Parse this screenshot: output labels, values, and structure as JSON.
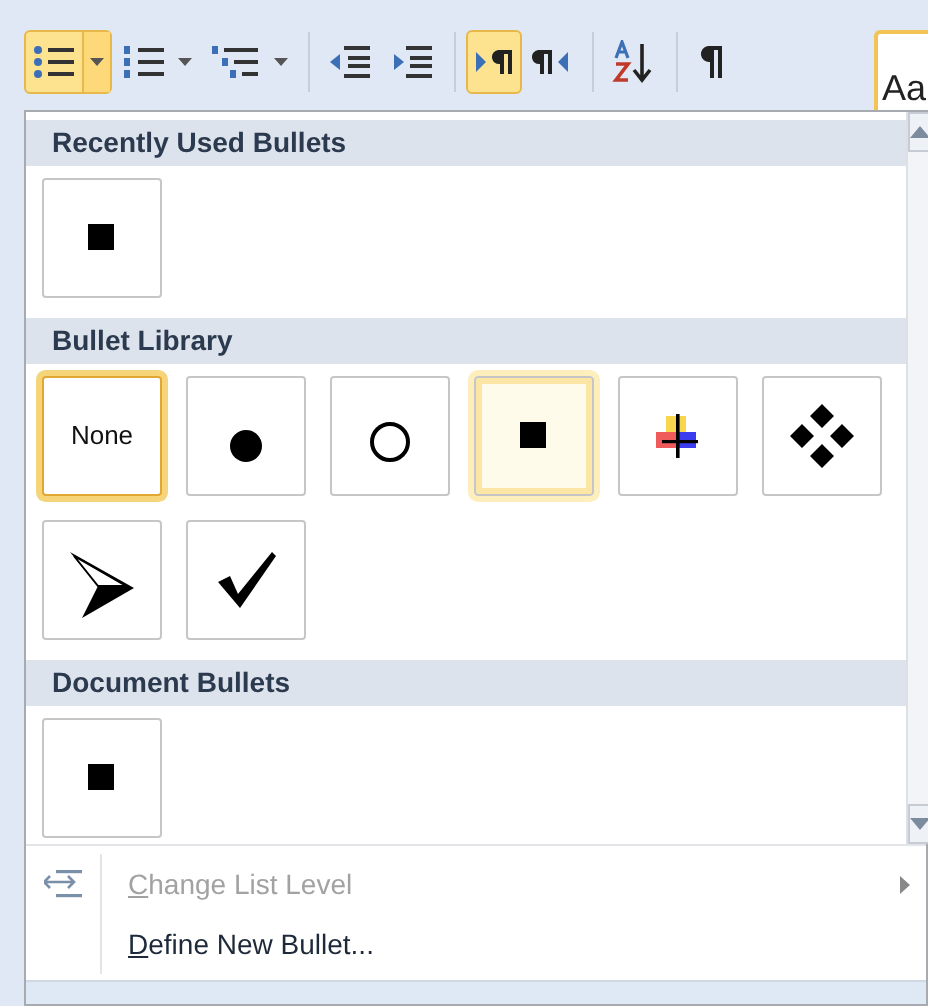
{
  "toolbar": {
    "groups": [
      [
        {
          "kind": "bullets",
          "selected": true,
          "split": true
        },
        {
          "kind": "numbering",
          "selected": false,
          "split": true
        },
        {
          "kind": "multilevel",
          "selected": false,
          "split": true
        }
      ],
      [
        {
          "kind": "decrease-indent",
          "selected": false,
          "split": false
        },
        {
          "kind": "increase-indent",
          "selected": false,
          "split": false
        }
      ],
      [
        {
          "kind": "ltr",
          "selected": true,
          "split": false
        },
        {
          "kind": "rtl",
          "selected": false,
          "split": false
        }
      ],
      [
        {
          "kind": "sort",
          "selected": false,
          "split": false
        }
      ],
      [
        {
          "kind": "pilcrow",
          "selected": false,
          "split": false
        }
      ]
    ],
    "style_preview": "Aa"
  },
  "gallery": {
    "sections": [
      {
        "title": "Recently Used Bullets",
        "items": [
          {
            "kind": "square",
            "selected": false,
            "hovered": false
          }
        ]
      },
      {
        "title": "Bullet Library",
        "items": [
          {
            "kind": "text",
            "label": "None",
            "selected": false,
            "hovered": true
          },
          {
            "kind": "disc",
            "selected": false,
            "hovered": false
          },
          {
            "kind": "circle",
            "selected": false,
            "hovered": false
          },
          {
            "kind": "square",
            "selected": true,
            "hovered": false
          },
          {
            "kind": "plus",
            "selected": false,
            "hovered": false
          },
          {
            "kind": "diamonds",
            "selected": false,
            "hovered": false
          },
          {
            "kind": "arrowhead",
            "selected": false,
            "hovered": false
          },
          {
            "kind": "check",
            "selected": false,
            "hovered": false
          }
        ]
      },
      {
        "title": "Document Bullets",
        "items": [
          {
            "kind": "square",
            "selected": false,
            "hovered": false
          }
        ]
      }
    ]
  },
  "menu": [
    {
      "kind": "change-level",
      "label": "Change List Level",
      "disabled": true,
      "submenu": true
    },
    {
      "kind": "plain",
      "label": "Define New Bullet...",
      "disabled": false,
      "submenu": false
    }
  ]
}
